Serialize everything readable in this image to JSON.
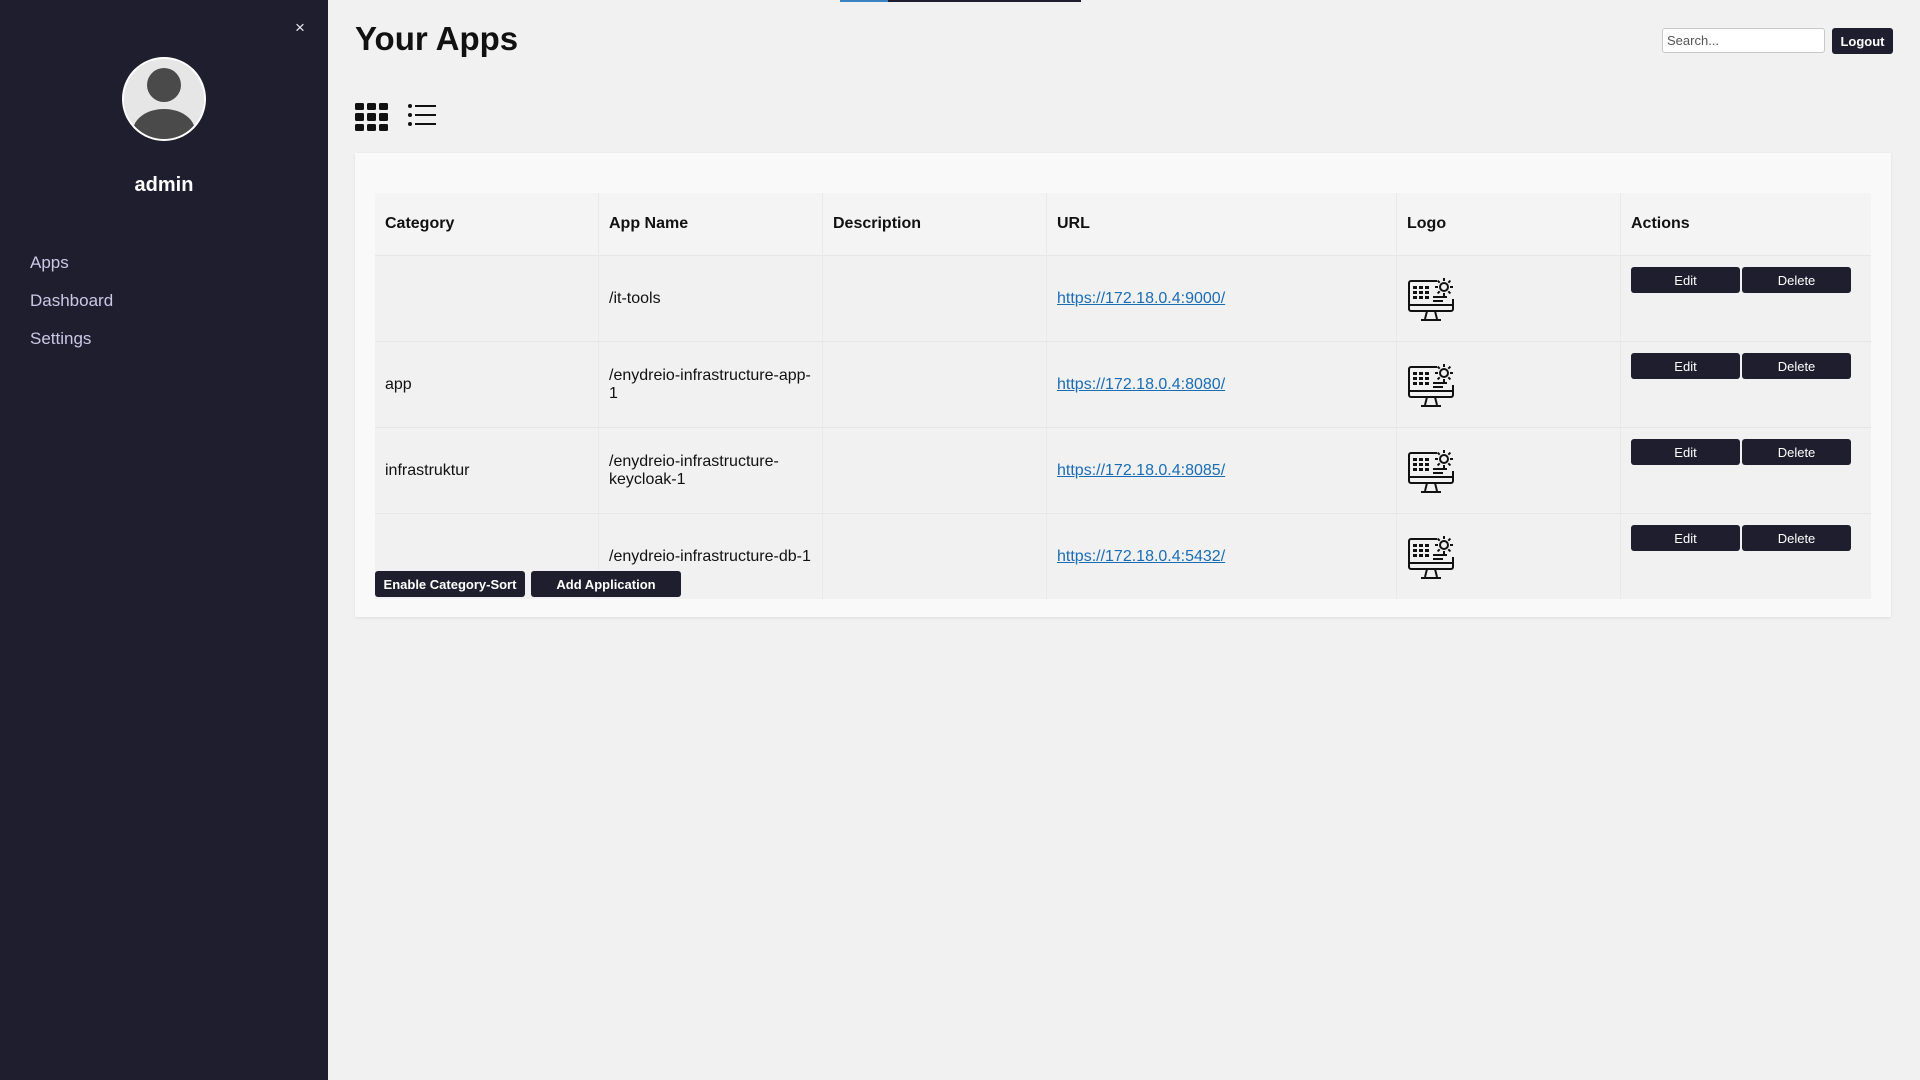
{
  "sidebar": {
    "close_label": "×",
    "username": "admin",
    "nav": [
      "Apps",
      "Dashboard",
      "Settings"
    ]
  },
  "header": {
    "title": "Your Apps",
    "search_placeholder": "Search...",
    "logout_label": "Logout"
  },
  "view_toggle": {
    "grid_icon": "grid-view-icon",
    "list_icon": "list-view-icon"
  },
  "table": {
    "headers": [
      "Category",
      "App Name",
      "Description",
      "URL",
      "Logo",
      "Actions"
    ],
    "rows": [
      {
        "category": "",
        "app_name": "/it-tools",
        "description": "",
        "url": "https://172.18.0.4:9000/",
        "logo": "monitor-gear-icon"
      },
      {
        "category": "app",
        "app_name": "/enydreio-infrastructure-app-1",
        "description": "",
        "url": "https://172.18.0.4:8080/",
        "logo": "monitor-gear-icon"
      },
      {
        "category": "infrastruktur",
        "app_name": "/enydreio-infrastructure-keycloak-1",
        "description": "",
        "url": "https://172.18.0.4:8085/",
        "logo": "monitor-gear-icon"
      },
      {
        "category": "",
        "app_name": "/enydreio-infrastructure-db-1",
        "description": "",
        "url": "https://172.18.0.4:5432/",
        "logo": "monitor-gear-icon"
      }
    ],
    "edit_label": "Edit",
    "delete_label": "Delete"
  },
  "footer": {
    "category_sort_label": "Enable Category-Sort",
    "add_app_label": "Add Application"
  },
  "colors": {
    "sidebar_bg": "#1f1e2e",
    "button_bg": "#1f1e2e",
    "link": "#1a6db5",
    "page_bg": "#f1f1f1"
  }
}
